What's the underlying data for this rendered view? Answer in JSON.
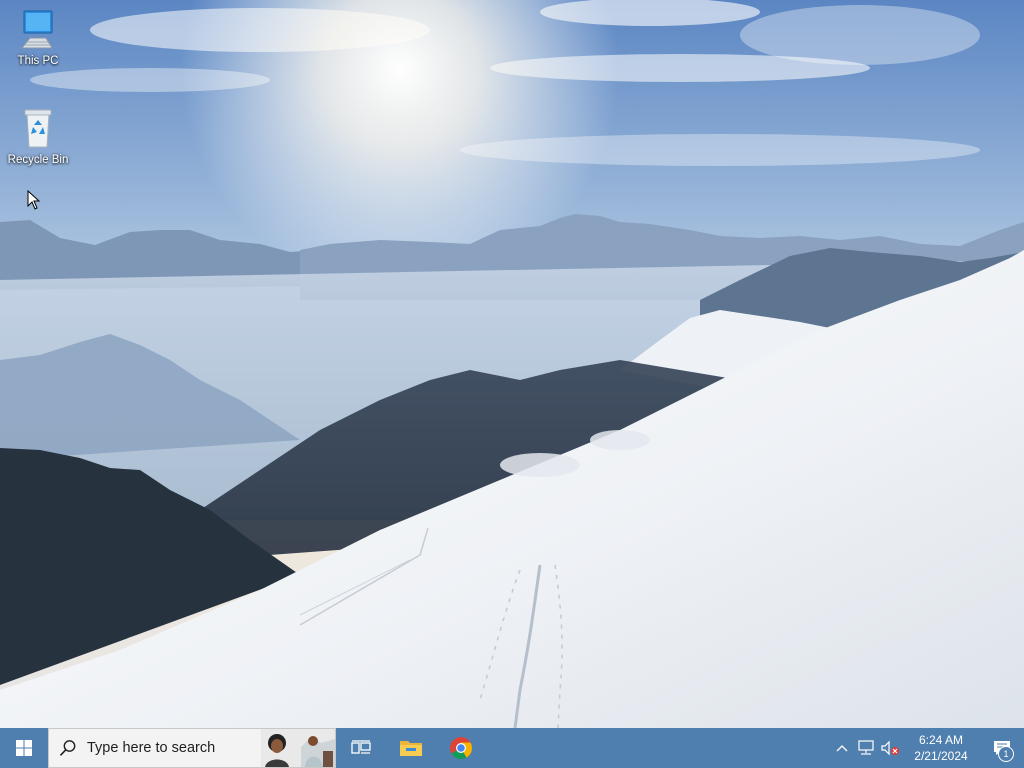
{
  "desktop": {
    "icons": [
      {
        "label": "This PC",
        "icon": "computer-icon"
      },
      {
        "label": "Recycle Bin",
        "icon": "recycle-bin-icon"
      }
    ]
  },
  "taskbar": {
    "start_icon": "windows-logo-icon",
    "search": {
      "placeholder": "Type here to search",
      "icon": "search-icon"
    },
    "pinned": [
      {
        "icon": "task-view-icon"
      },
      {
        "icon": "file-explorer-icon"
      },
      {
        "icon": "chrome-icon"
      }
    ],
    "tray": {
      "icons": [
        "chevron-up-icon",
        "network-icon",
        "volume-muted-icon"
      ],
      "time": "6:24 AM",
      "date": "2/21/2024",
      "notification_count": "1"
    }
  },
  "colors": {
    "taskbar": "#4f7fae",
    "sky_top": "#5a86c4",
    "snow": "#f4f6f8"
  }
}
